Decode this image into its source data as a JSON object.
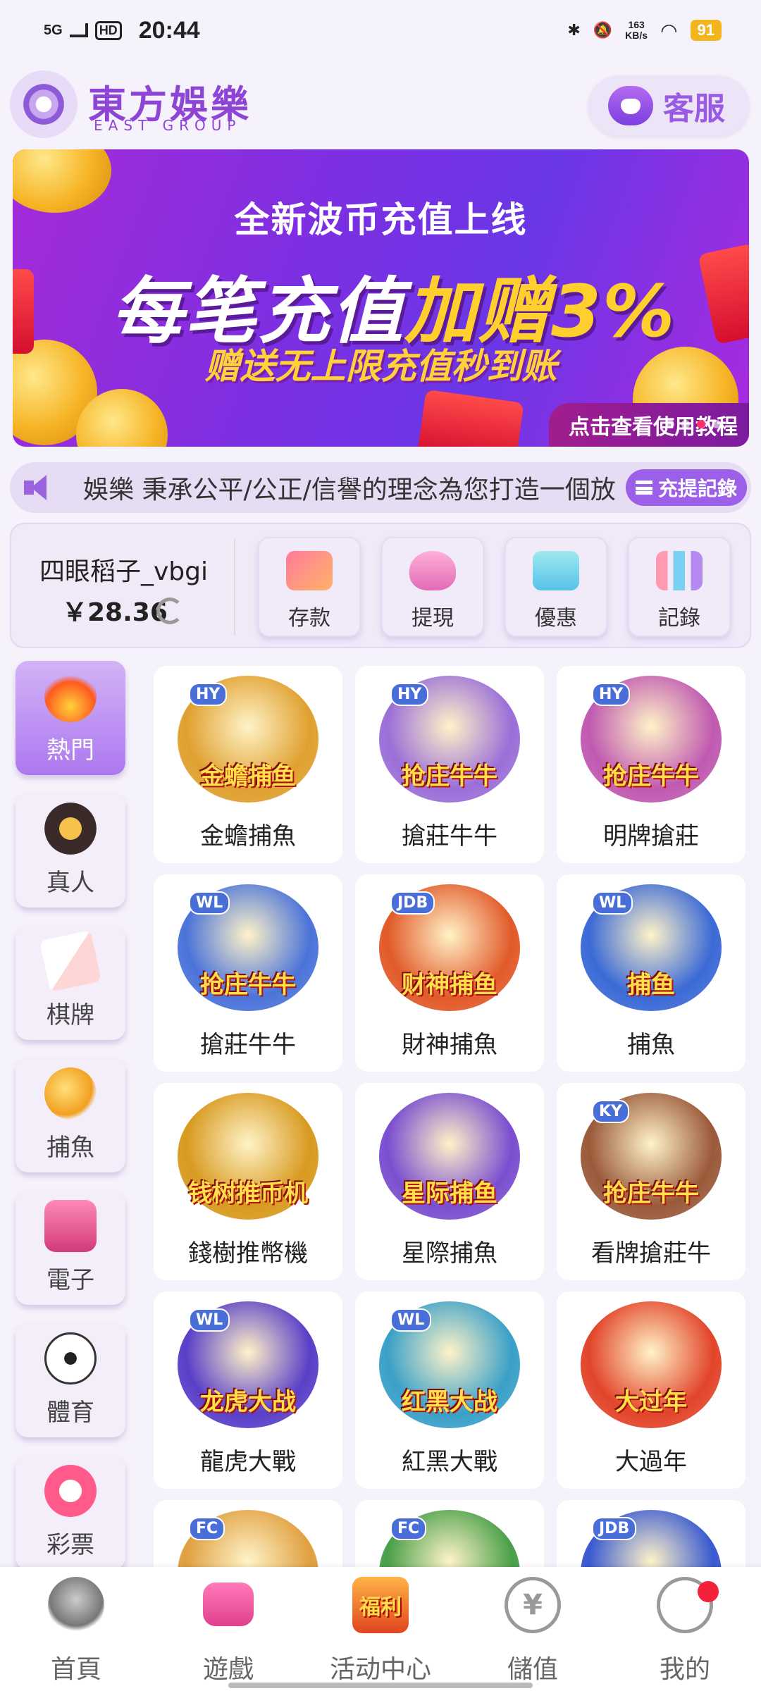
{
  "status_bar": {
    "network": "5G",
    "hd": "HD",
    "time": "20:44",
    "speed_value": "163",
    "speed_unit": "KB/s",
    "battery": "91"
  },
  "header": {
    "brand_name": "東方娛樂",
    "brand_subtitle": "EAST GROUP",
    "service_label": "客服"
  },
  "banner": {
    "line1": "全新波币充值上线",
    "line2_a": "每笔充值",
    "line2_b": "加赠3%",
    "line3": "赠送无上限充值秒到账",
    "button": "点击查看使用教程"
  },
  "marquee": {
    "text": "娛樂 秉承公平/公正/信譽的理念為您打造一個放",
    "records_button": "充提記錄"
  },
  "account": {
    "username": "四眼稻子_vbgi",
    "balance": "￥28.36",
    "actions": [
      {
        "label": "存款",
        "icon": "card-icon"
      },
      {
        "label": "提現",
        "icon": "money-bag-icon"
      },
      {
        "label": "優惠",
        "icon": "gift-icon"
      },
      {
        "label": "記錄",
        "icon": "bar-chart-icon"
      }
    ]
  },
  "categories": [
    {
      "label": "熱門",
      "icon": "fire-icon",
      "active": true
    },
    {
      "label": "真人",
      "icon": "chip-icon"
    },
    {
      "label": "棋牌",
      "icon": "cards-icon"
    },
    {
      "label": "捕魚",
      "icon": "fish-icon"
    },
    {
      "label": "電子",
      "icon": "slot-icon"
    },
    {
      "label": "體育",
      "icon": "soccer-ball-icon"
    },
    {
      "label": "彩票",
      "icon": "lottery-ball-icon"
    }
  ],
  "games": [
    {
      "label": "金蟾捕魚",
      "tag": "HY",
      "art": "金蟾捕鱼",
      "color": "#e0a030"
    },
    {
      "label": "搶莊牛牛",
      "tag": "HY",
      "art": "抢庄牛牛",
      "color": "#9a6fd8"
    },
    {
      "label": "明牌搶莊",
      "tag": "HY",
      "art": "抢庄牛牛",
      "color": "#c05ab0"
    },
    {
      "label": "搶莊牛牛",
      "tag": "WL",
      "art": "抢庄牛牛",
      "color": "#4b73d9"
    },
    {
      "label": "財神捕魚",
      "tag": "JDB",
      "art": "财神捕鱼",
      "color": "#e25a2a"
    },
    {
      "label": "捕魚",
      "tag": "WL",
      "art": "捕鱼",
      "color": "#3b6ad6"
    },
    {
      "label": "錢樹推幣機",
      "tag": "",
      "art": "钱树推币机",
      "color": "#d89a20"
    },
    {
      "label": "星際捕魚",
      "tag": "",
      "art": "星际捕鱼",
      "color": "#7a4fd0"
    },
    {
      "label": "看牌搶莊牛",
      "tag": "KY",
      "art": "抢庄牛牛",
      "color": "#9a5a3a"
    },
    {
      "label": "龍虎大戰",
      "tag": "WL",
      "art": "龙虎大战",
      "color": "#5a3fc8"
    },
    {
      "label": "紅黑大戰",
      "tag": "WL",
      "art": "红黑大战",
      "color": "#3aa0c8"
    },
    {
      "label": "大過年",
      "tag": "",
      "art": "大过年",
      "color": "#e2452a"
    },
    {
      "label": "",
      "tag": "FC",
      "art": "",
      "color": "#e0a040"
    },
    {
      "label": "",
      "tag": "FC",
      "art": "",
      "color": "#4aa04a"
    },
    {
      "label": "",
      "tag": "JDB",
      "art": "",
      "color": "#3a5ad0"
    }
  ],
  "bottom_nav": [
    {
      "label": "首頁",
      "icon": "lady-face-icon"
    },
    {
      "label": "遊戲",
      "icon": "gamepad-icon"
    },
    {
      "label": "活动中心",
      "icon": "treasure-chest-icon",
      "art": "福利"
    },
    {
      "label": "儲值",
      "icon": "yuan-deposit-icon"
    },
    {
      "label": "我的",
      "icon": "user-icon"
    }
  ]
}
